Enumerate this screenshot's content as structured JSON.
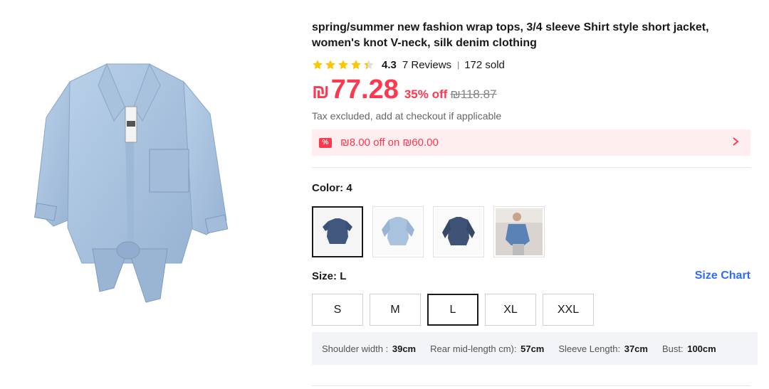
{
  "product": {
    "title": "spring/summer new fashion wrap tops, 3/4 sleeve Shirt style short jacket, women's knot V-neck, silk denim clothing",
    "rating": "4.3",
    "rating_value": 4.3,
    "reviews": "7 Reviews",
    "sold": "172 sold",
    "currency_symbol": "₪",
    "price": "77.28",
    "discount": "35% off",
    "original_price": "₪118.87",
    "tax_note": "Tax excluded, add at checkout if applicable"
  },
  "coupon": {
    "icon": "coupon-icon",
    "icon_glyph": "%",
    "text": "₪8.00 off on ₪60.00"
  },
  "color": {
    "label": "Color: ",
    "selected": "4",
    "swatch_names": [
      "swatch-1",
      "swatch-2",
      "swatch-3",
      "swatch-4"
    ]
  },
  "size": {
    "label": "Size: ",
    "selected": "L",
    "chart_link": "Size Chart",
    "options": [
      "S",
      "M",
      "L",
      "XL",
      "XXL"
    ]
  },
  "measurements": [
    {
      "label": "Shoulder width :",
      "value": "39cm"
    },
    {
      "label": "Rear mid-length cm):",
      "value": "57cm"
    },
    {
      "label": "Sleeve Length:",
      "value": "37cm"
    },
    {
      "label": "Bust:",
      "value": "100cm"
    }
  ],
  "colors": {
    "accent": "#fd384f",
    "link": "#2f6bff",
    "star": "#fdc600",
    "denim_light": "#a9c3de",
    "denim_dark": "#41577e"
  }
}
